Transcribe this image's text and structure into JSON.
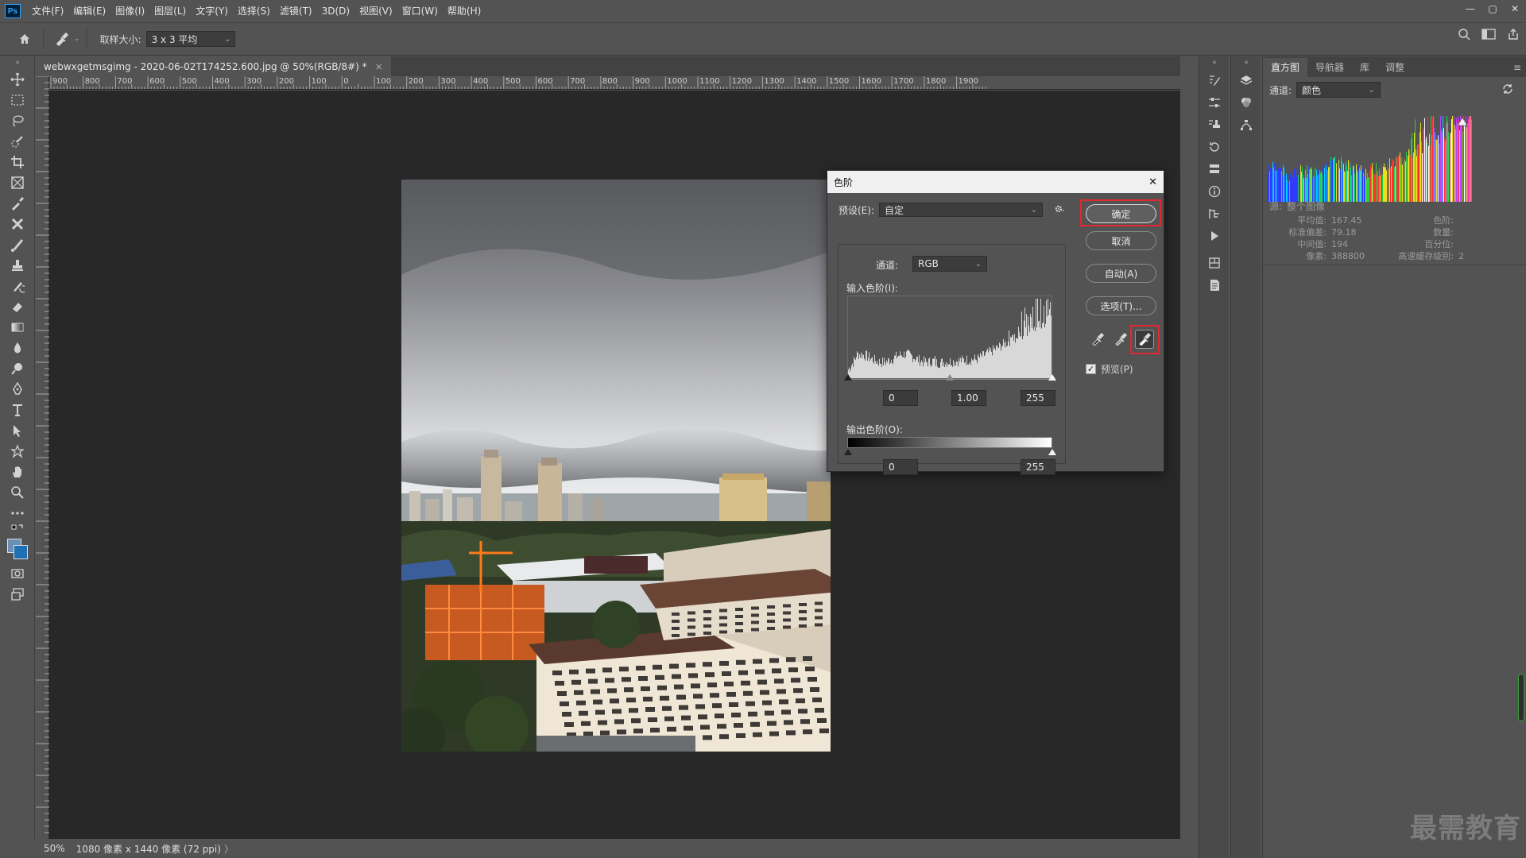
{
  "app": {
    "logo": "Ps",
    "menu": [
      "文件(F)",
      "编辑(E)",
      "图像(I)",
      "图层(L)",
      "文字(Y)",
      "选择(S)",
      "滤镜(T)",
      "3D(D)",
      "视图(V)",
      "窗口(W)",
      "帮助(H)"
    ],
    "window_controls": {
      "minimize": "—",
      "restore": "▢",
      "close": "✕"
    }
  },
  "options_bar": {
    "sample_size_label": "取样大小:",
    "sample_size_value": "3 x 3 平均"
  },
  "document": {
    "tab_title": "webwxgetmsgimg - 2020-06-02T174252.600.jpg @ 50%(RGB/8#) *",
    "tab_close": "×",
    "ruler_labels": [
      "900",
      "800",
      "700",
      "600",
      "500",
      "400",
      "300",
      "200",
      "100",
      "0",
      "100",
      "200",
      "300",
      "400",
      "500",
      "600",
      "700",
      "800",
      "900",
      "1000",
      "1100",
      "1200",
      "1300",
      "1400",
      "1500",
      "1600",
      "1700",
      "1800",
      "1900"
    ],
    "zoom": "50%",
    "doc_info": "1080 像素 x 1440 像素 (72 ppi)",
    "doc_info_arrow": "〉"
  },
  "levels_dialog": {
    "title": "色阶",
    "close": "✕",
    "preset_label": "预设(E):",
    "preset_value": "自定",
    "channel_label": "通道:",
    "channel_value": "RGB",
    "input_label": "输入色阶(I):",
    "input_black": "0",
    "input_gamma": "1.00",
    "input_white": "255",
    "output_label": "输出色阶(O):",
    "output_black": "0",
    "output_white": "255",
    "ok_button": "确定",
    "cancel_button": "取消",
    "auto_button": "自动(A)",
    "options_button": "选项(T)...",
    "preview_label": "预览(P)",
    "preview_checked": true,
    "highlight_color": "#e0282e"
  },
  "histogram_panel": {
    "tabs": [
      "直方图",
      "导航器",
      "库",
      "调整"
    ],
    "active_tab": "直方图",
    "channel_label": "通道:",
    "channel_value": "颜色",
    "source_label": "源:",
    "source_value": "整个图像",
    "stats_left": [
      {
        "label": "平均值:",
        "value": "167.45"
      },
      {
        "label": "标准偏差:",
        "value": "79.18"
      },
      {
        "label": "中间值:",
        "value": "194"
      },
      {
        "label": "像素:",
        "value": "388800"
      }
    ],
    "stats_right": [
      {
        "label": "色阶:",
        "value": ""
      },
      {
        "label": "数量:",
        "value": ""
      },
      {
        "label": "百分位:",
        "value": ""
      },
      {
        "label": "高速缓存级别:",
        "value": "2"
      }
    ]
  },
  "watermark": "最需教育",
  "colors": {
    "ui_bg": "#535353",
    "canvas_bg": "#282828",
    "accent_highlight": "#e0282e"
  }
}
